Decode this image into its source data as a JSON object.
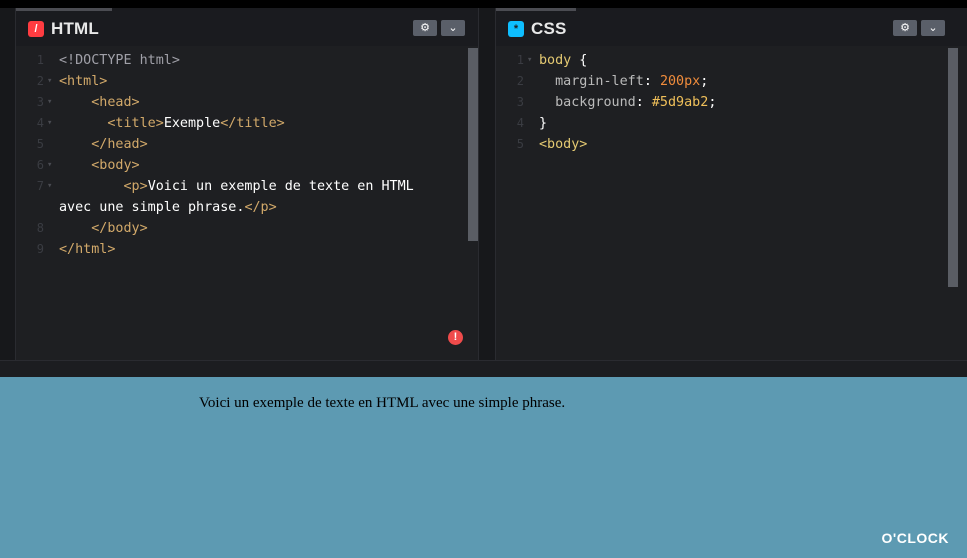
{
  "html_panel": {
    "title": "HTML",
    "icon": "html-icon",
    "line_numbers": [
      "1",
      "2",
      "3",
      "4",
      "5",
      "6",
      "7",
      "",
      "8",
      "9"
    ],
    "lines": [
      [
        {
          "t": "<!DOCTYPE html>",
          "c": "doctype"
        }
      ],
      [
        {
          "t": "<html>",
          "c": "tag"
        }
      ],
      [
        {
          "t": "    <head>",
          "c": "tag"
        }
      ],
      [
        {
          "t": "      <title>",
          "c": "tag"
        },
        {
          "t": "Exemple",
          "c": "plain"
        },
        {
          "t": "</title>",
          "c": "tag"
        }
      ],
      [
        {
          "t": "    </head>",
          "c": "tag"
        }
      ],
      [
        {
          "t": "    <body>",
          "c": "tag"
        }
      ],
      [
        {
          "t": "        <p>",
          "c": "tag"
        },
        {
          "t": "Voici un exemple de texte en HTML",
          "c": "plain"
        }
      ],
      [
        {
          "t": "avec une simple phrase.",
          "c": "plain"
        },
        {
          "t": "</p>",
          "c": "tag"
        }
      ],
      [
        {
          "t": "    </body>",
          "c": "tag"
        }
      ],
      [
        {
          "t": "</html>",
          "c": "tag"
        }
      ]
    ]
  },
  "css_panel": {
    "title": "CSS",
    "icon": "css-icon",
    "line_numbers": [
      "1",
      "2",
      "3",
      "4",
      "5"
    ],
    "lines": [
      [
        {
          "t": "body",
          "c": "sel"
        },
        {
          "t": " {",
          "c": "plain"
        }
      ],
      [
        {
          "t": "  margin-left",
          "c": "prop"
        },
        {
          "t": ": ",
          "c": "plain"
        },
        {
          "t": "200px",
          "c": "num"
        },
        {
          "t": ";",
          "c": "plain"
        }
      ],
      [
        {
          "t": "  background",
          "c": "prop"
        },
        {
          "t": ": ",
          "c": "plain"
        },
        {
          "t": "#5d9ab2",
          "c": "hex"
        },
        {
          "t": ";",
          "c": "plain"
        }
      ],
      [
        {
          "t": "}",
          "c": "plain"
        }
      ],
      [
        {
          "t": "<body>",
          "c": "sel"
        }
      ]
    ]
  },
  "preview": {
    "text": "Voici un exemple de texte en HTML avec une simple phrase.",
    "background": "#5d9ab2"
  },
  "controls": {
    "gear_icon": "⚙",
    "chevron_icon": "⌄"
  },
  "error_icon": "!",
  "watermark": "O'CLOCK",
  "colors": {
    "html_icon": "#ff3c41",
    "css_icon": "#0ebeff",
    "error": "#ef4b4b"
  }
}
